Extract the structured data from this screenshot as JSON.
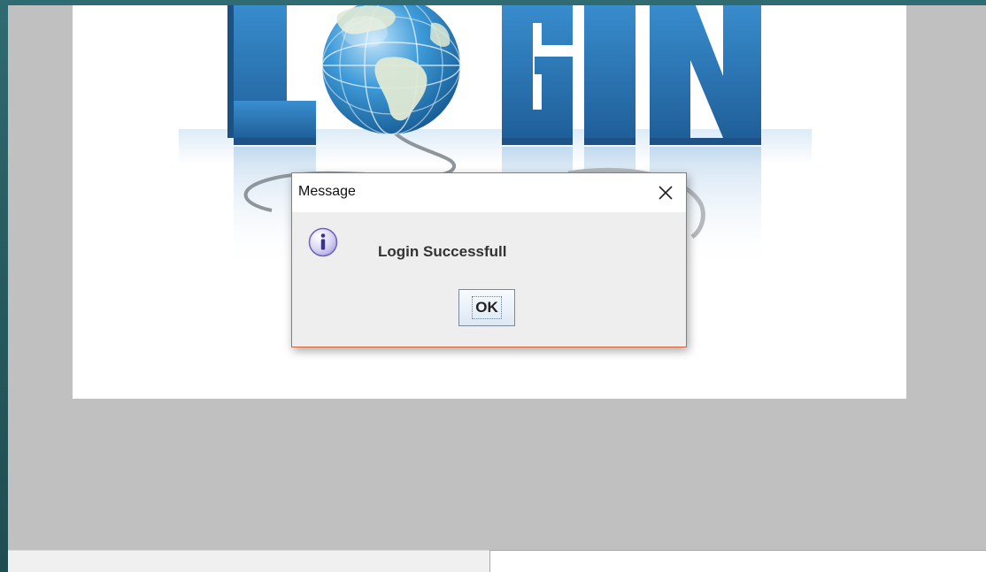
{
  "banner": {
    "word_left": "L",
    "word_right": "GIN",
    "icon": "globe-icon"
  },
  "dialog": {
    "title": "Message",
    "close_icon": "close-icon",
    "info_icon": "info-icon",
    "message": "Login Successfull",
    "ok_label": "OK"
  },
  "colors": {
    "desktop": "#2b5f63",
    "window_bg": "#c0c0c0",
    "dialog_border": "#d2643a",
    "banner_blue": "#2e78b7"
  }
}
